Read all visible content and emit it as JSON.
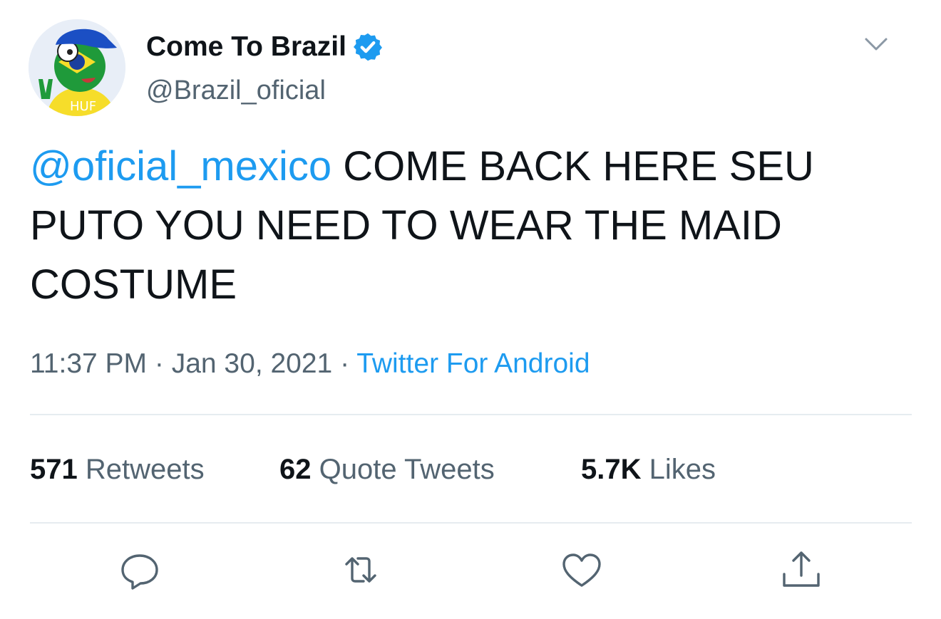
{
  "author": {
    "display_name": "Come To Brazil",
    "handle": "@Brazil_oficial",
    "verified": true,
    "avatar_text": "HUF"
  },
  "tweet": {
    "mention": "@oficial_mexico",
    "text": " COME BACK HERE SEU PUTO YOU NEED TO WEAR THE MAID COSTUME"
  },
  "meta": {
    "time": "11:37 PM",
    "separator": " · ",
    "date": "Jan 30, 2021",
    "source": "Twitter For Android"
  },
  "stats": {
    "retweets_count": "571",
    "retweets_label": "Retweets",
    "quotes_count": "62",
    "quotes_label": "Quote Tweets",
    "likes_count": "5.7K",
    "likes_label": "Likes"
  },
  "actions": [
    "reply-icon",
    "retweet-icon",
    "like-icon",
    "share-icon"
  ],
  "colors": {
    "accent": "#1d9bf0",
    "text": "#0f1419",
    "muted": "#536471",
    "divider": "#e6ecf0"
  }
}
